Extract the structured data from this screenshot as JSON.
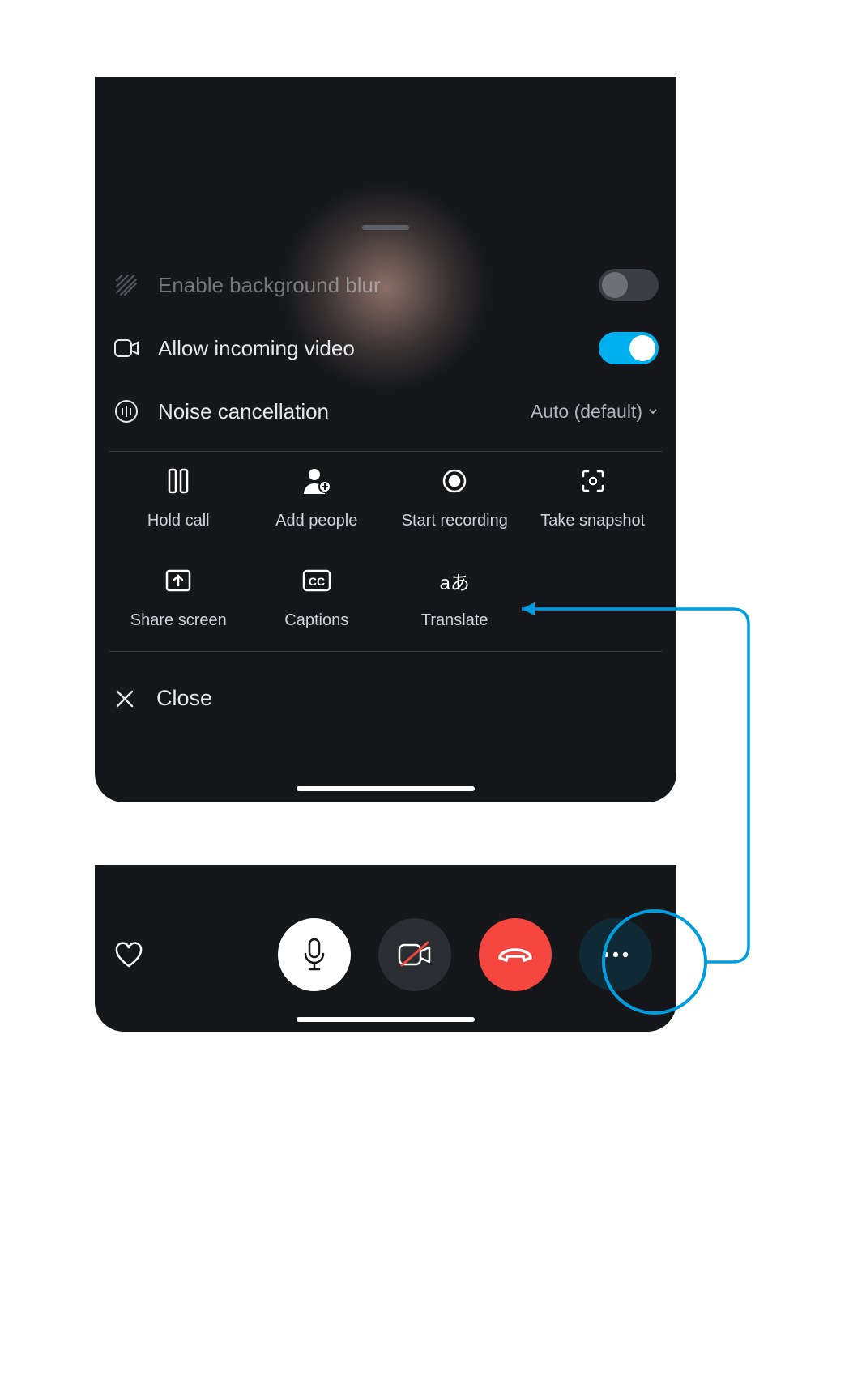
{
  "sheet": {
    "bg_blur_label": "Enable background blur",
    "bg_blur_on": false,
    "incoming_video_label": "Allow incoming video",
    "incoming_video_on": true,
    "noise_label": "Noise cancellation",
    "noise_value": "Auto (default)",
    "actions": [
      {
        "id": "hold",
        "label": "Hold call"
      },
      {
        "id": "addpeople",
        "label": "Add people"
      },
      {
        "id": "record",
        "label": "Start recording"
      },
      {
        "id": "snapshot",
        "label": "Take snapshot"
      },
      {
        "id": "share",
        "label": "Share screen"
      },
      {
        "id": "captions",
        "label": "Captions"
      },
      {
        "id": "translate",
        "label": "Translate"
      }
    ],
    "close_label": "Close"
  },
  "callbar": {
    "mic_muted": false,
    "video_on": false
  },
  "colors": {
    "accent": "#00aff0",
    "hangup": "#f4463f",
    "annotation": "#009de0"
  }
}
